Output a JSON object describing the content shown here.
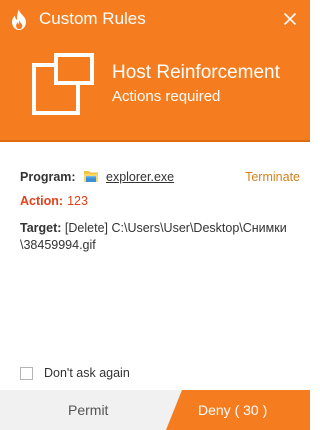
{
  "window": {
    "title": "Custom Rules",
    "close_icon": "close-icon",
    "app_icon": "flame-icon"
  },
  "header": {
    "icon": "window-restore-icon",
    "title": "Host Reinforcement",
    "subtitle": "Actions required",
    "color": "#f57c1f"
  },
  "details": {
    "program_label": "Program:",
    "program_icon": "explorer-folder-icon",
    "program_name": "explorer.exe",
    "terminate_label": "Terminate",
    "action_label": "Action:",
    "action_value": "123",
    "target_label": "Target:",
    "target_value": "[Delete] C:\\Users\\User\\Desktop\\Снимки\\38459994.gif"
  },
  "options": {
    "dont_ask_label": "Don't ask again",
    "dont_ask_checked": false
  },
  "footer": {
    "permit_label": "Permit",
    "deny_label": "Deny ( 30 )",
    "accent_color": "#f57c1f"
  }
}
